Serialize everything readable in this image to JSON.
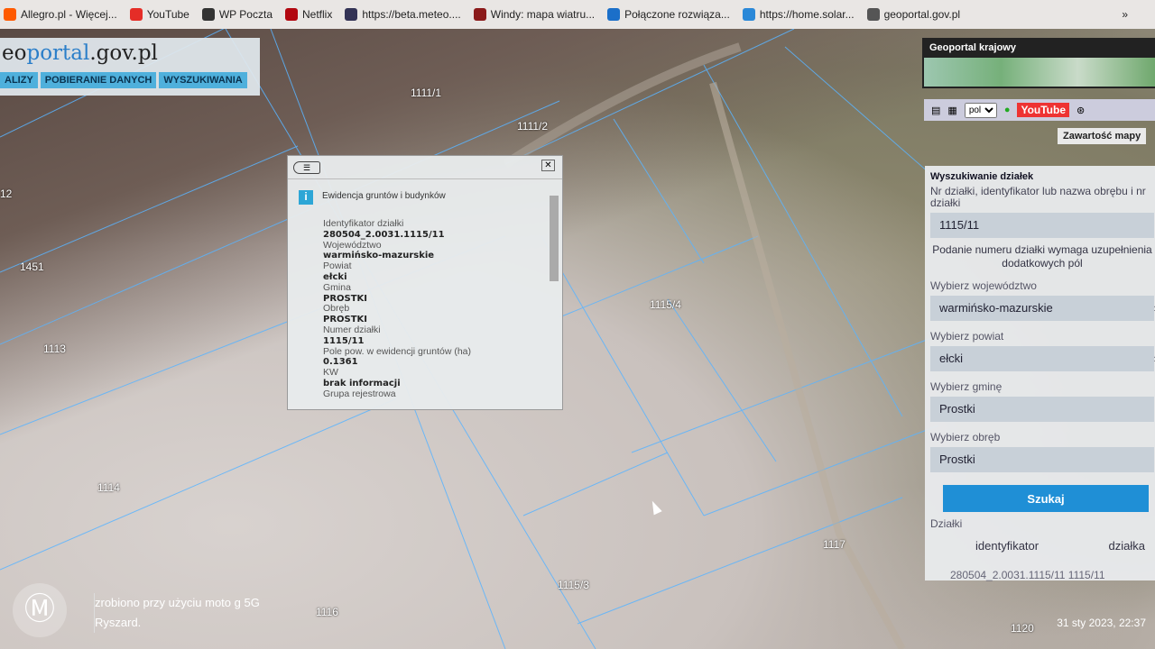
{
  "bookmarks": [
    {
      "label": "Allegro.pl - Więcej...",
      "color": "#ff5a00"
    },
    {
      "label": "YouTube",
      "color": "#e52d27"
    },
    {
      "label": "WP Poczta",
      "color": "#333"
    },
    {
      "label": "Netflix",
      "color": "#b20710"
    },
    {
      "label": "https://beta.meteo....",
      "color": "#335"
    },
    {
      "label": "Windy: mapa wiatru...",
      "color": "#8b1a1a"
    },
    {
      "label": "Połączone rozwiąza...",
      "color": "#1b6fc9"
    },
    {
      "label": "https://home.solar...",
      "color": "#2a88d8"
    },
    {
      "label": "geoportal.gov.pl",
      "color": "#555"
    }
  ],
  "bookmarks_more": "»",
  "logo": {
    "pre": "eo",
    "accent": "portal",
    "post": ".gov.pl",
    "tabs": [
      "ALIZY",
      "POBIERANIE DANYCH",
      "WYSZUKIWANIA"
    ]
  },
  "national": {
    "title": "Geoportal krajowy"
  },
  "toolbar": {
    "language": "pol",
    "youtube": "YouTube"
  },
  "map_content_btn": "Zawartość mapy",
  "parcels": [
    "1111/1",
    "1111/2",
    "1115/4",
    "1451",
    "1113",
    "1114",
    "1116",
    "1117",
    "1115/3",
    "1120",
    "12"
  ],
  "popup": {
    "title": "Ewidencja gruntów i budynków",
    "fields": [
      {
        "label": "Identyfikator działki",
        "value": "280504_2.0031.1115/11"
      },
      {
        "label": "Województwo",
        "value": "warmińsko-mazurskie"
      },
      {
        "label": "Powiat",
        "value": "ełcki"
      },
      {
        "label": "Gmina",
        "value": "PROSTKI"
      },
      {
        "label": "Obręb",
        "value": "PROSTKI"
      },
      {
        "label": "Numer działki",
        "value": "1115/11"
      },
      {
        "label": "Pole pow. w ewidencji gruntów (ha)",
        "value": "0.1361"
      },
      {
        "label": "KW",
        "value": "brak informacji"
      }
    ],
    "last_label": "Grupa rejestrowa"
  },
  "search": {
    "title": "Wyszukiwanie działek",
    "query_label": "Nr działki, identyfikator lub nazwa obrębu i nr działki",
    "query_value": "1115/11",
    "hint": "Podanie numeru działki wymaga uzupełnienia dodatkowych pól",
    "voiv_label": "Wybierz województwo",
    "voiv_value": "warmińsko-mazurskie",
    "powiat_label": "Wybierz powiat",
    "powiat_value": "ełcki",
    "gmina_label": "Wybierz gminę",
    "gmina_value": "Prostki",
    "obreb_label": "Wybierz obręb",
    "obreb_value": "Prostki",
    "button": "Szukaj",
    "results_label": "Działki",
    "col_id": "identyfikator",
    "col_parcel": "działka",
    "row": "280504_2.0031.1115/11     1115/11"
  },
  "watermark": {
    "line1": "zrobiono przy użyciu moto g 5G",
    "line2": "Ryszard."
  },
  "timestamp": "31 sty 2023, 22:37"
}
